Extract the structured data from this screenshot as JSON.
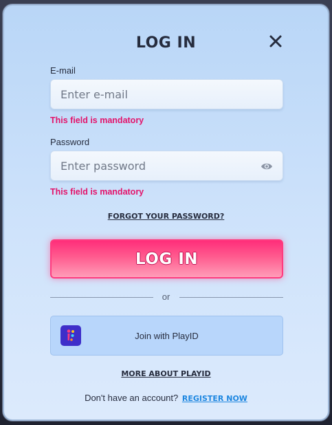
{
  "modal": {
    "title": "LOG IN",
    "close_icon": "close-icon"
  },
  "email": {
    "label": "E-mail",
    "value": "",
    "placeholder": "Enter e-mail",
    "error": "This field is mandatory"
  },
  "password": {
    "label": "Password",
    "value": "",
    "placeholder": "Enter password",
    "error": "This field is mandatory",
    "toggle_icon": "eye-icon"
  },
  "forgot_password": "FORGOT YOUR PASSWORD?",
  "login_button": "LOG IN",
  "separator": "or",
  "playid": {
    "label": "Join with PlayID",
    "logo_icon": "playid-logo-icon",
    "more_link": "MORE ABOUT PLAYID"
  },
  "register": {
    "prompt": "Don't have an account?",
    "link": "REGISTER NOW"
  },
  "colors": {
    "accent_pink": "#ff2e7a",
    "error": "#e3136a",
    "link_blue": "#1c86e0",
    "playid_purple": "#3e2ec9"
  }
}
